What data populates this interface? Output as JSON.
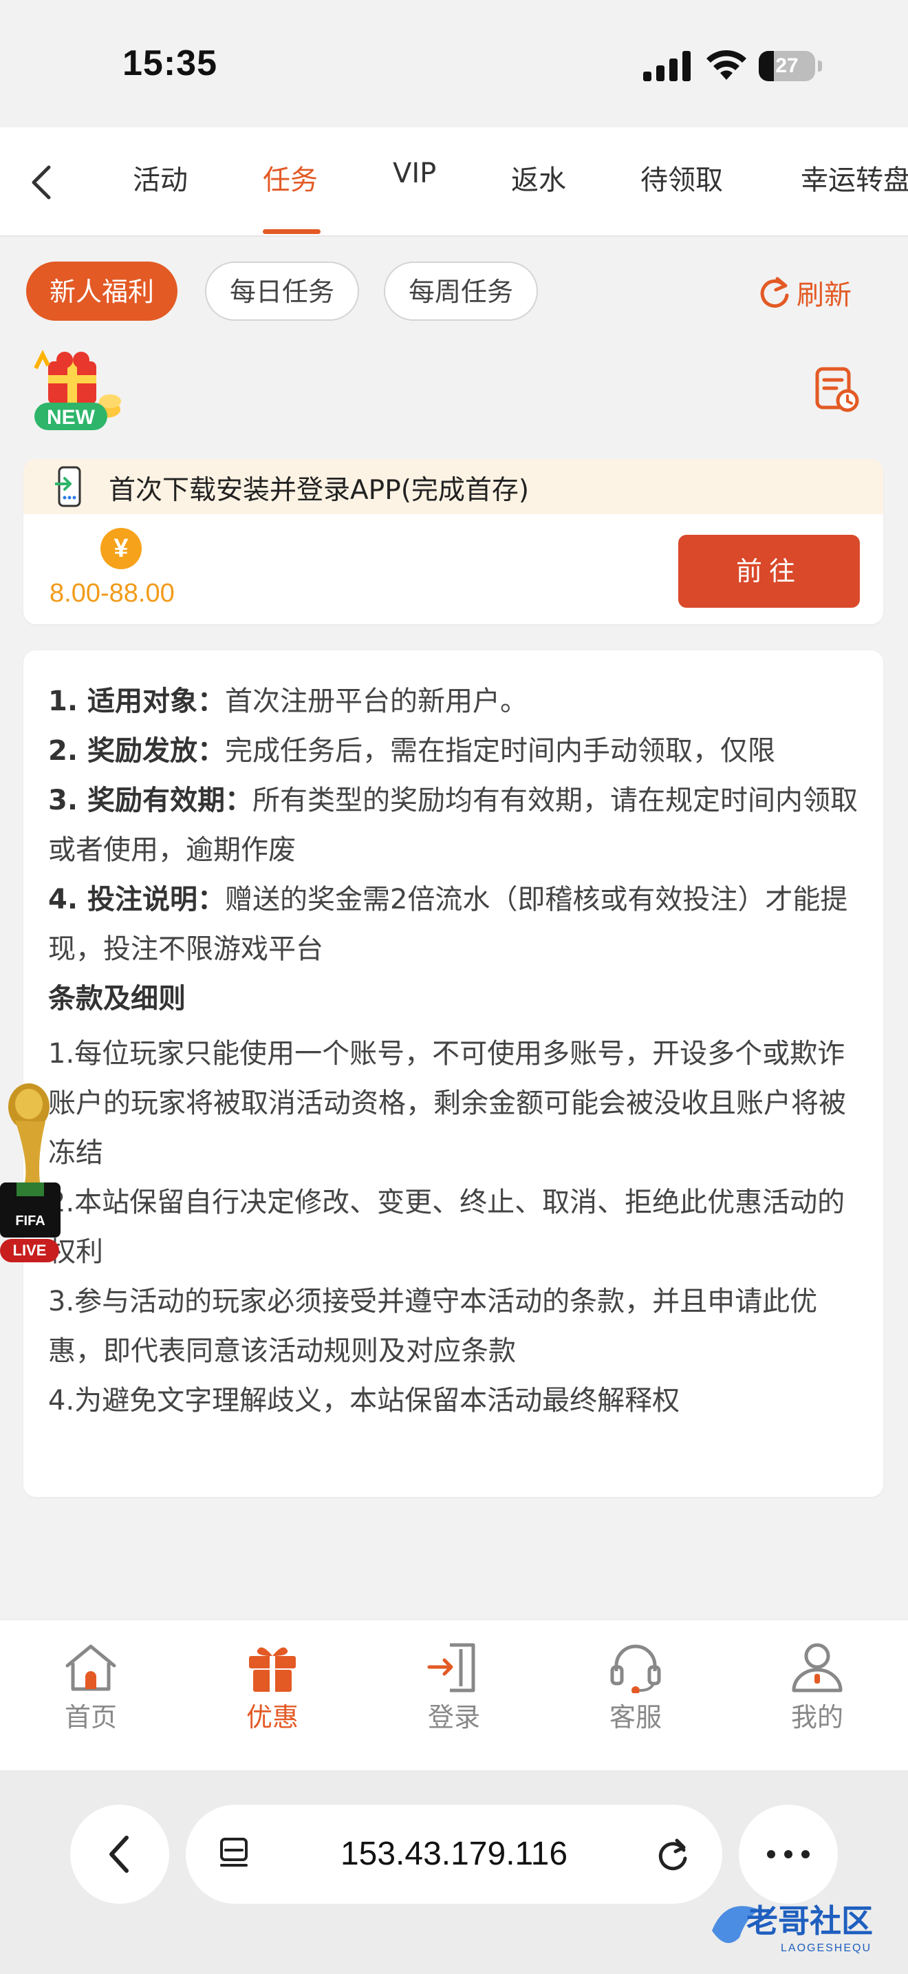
{
  "status_bar": {
    "time": "15:35",
    "battery": "27",
    "battery_level": 0.27
  },
  "tabs": [
    {
      "label": "活动"
    },
    {
      "label": "任务",
      "active": true
    },
    {
      "label": "VIP"
    },
    {
      "label": "返水"
    },
    {
      "label": "待领取"
    },
    {
      "label": "幸运转盘"
    }
  ],
  "filters": {
    "chips": [
      "新人福利",
      "每日任务",
      "每周任务"
    ],
    "active": "新人福利",
    "refresh": "刷新"
  },
  "badge": {
    "text": "NEW"
  },
  "task": {
    "title": "首次下载安装并登录APP(完成首存)",
    "coin_symbol": "¥",
    "reward": "8.00-88.00",
    "button": "前往"
  },
  "rules": {
    "items": [
      {
        "label": "1. 适用对象：",
        "text": "首次注册平台的新用户。"
      },
      {
        "label": "2. 奖励发放：",
        "text": "完成任务后，需在指定时间内手动领取，仅限"
      },
      {
        "label": "3. 奖励有效期：",
        "text": "所有类型的奖励均有有效期，请在规定时间内领取或者使用，逾期作废"
      },
      {
        "label": "4. 投注说明：",
        "text": "赠送的奖金需2倍流水（即稽核或有效投注）才能提现，投注不限游戏平台"
      }
    ],
    "terms_title": "条款及细则",
    "terms": [
      "1.每位玩家只能使用一个账号，不可使用多账号，开设多个或欺诈账户的玩家将被取消活动资格，剩余金额可能会被没收且账户将被冻结",
      "2.本站保留自行决定修改、变更、终止、取消、拒绝此优惠活动的权利",
      "3.参与活动的玩家必须接受并遵守本活动的条款，并且申请此优惠，即代表同意该活动规则及对应条款",
      "4.为避免文字理解歧义，本站保留本活动最终解释权"
    ]
  },
  "floating": {
    "fifa": "FIFA",
    "live": "LIVE"
  },
  "bottom_nav": [
    {
      "label": "首页",
      "icon": "home-icon"
    },
    {
      "label": "优惠",
      "icon": "gift-icon",
      "active": true
    },
    {
      "label": "登录",
      "icon": "login-icon"
    },
    {
      "label": "客服",
      "icon": "headset-icon"
    },
    {
      "label": "我的",
      "icon": "user-icon"
    }
  ],
  "browser": {
    "url": "153.43.179.116"
  },
  "watermark": {
    "text": "老哥社区",
    "sub": "LAOGESHEQU"
  },
  "colors": {
    "accent": "#e35a25",
    "button": "#d9492a",
    "coin": "#f6a21a",
    "reward": "#f19b1a",
    "task_header_bg": "#fdf3e4"
  }
}
